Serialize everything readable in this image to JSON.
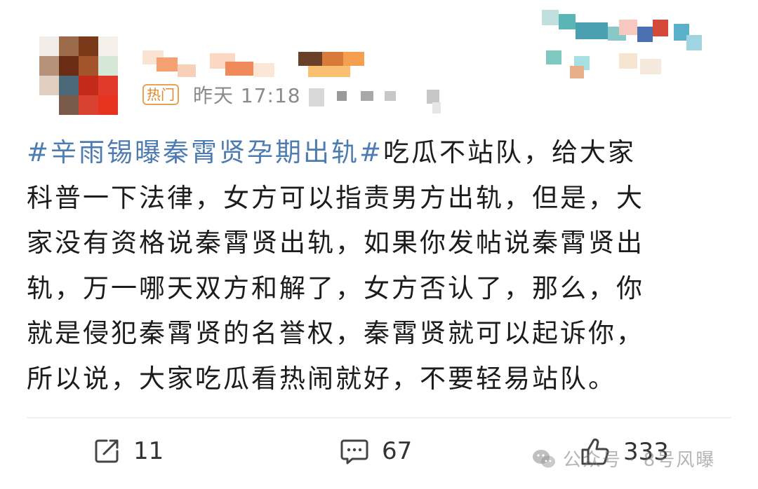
{
  "header": {
    "hot_badge": "热门",
    "time_text": "昨天 17:18"
  },
  "post": {
    "hashtag": "#辛雨锡曝秦霄贤孕期出轨#",
    "line1_rest": "吃瓜不站队，给大家",
    "line2": "科普一下法律，女方可以指责男方出轨，但是，大",
    "line3": "家没有资格说秦霄贤出轨，如果你发帖说秦霄贤出",
    "line4": "轨，万一哪天双方和解了，女方否认了，那么，你",
    "line5": "就是侵犯秦霄贤的名誉权，秦霄贤就可以起诉你，",
    "line6": "所以说，大家吃瓜看热闹就好，不要轻易站队。"
  },
  "actions": {
    "share_count": "11",
    "comment_count": "67",
    "like_count": "333"
  },
  "watermark": {
    "text": "公众号 · 8号风曝"
  },
  "colors": {
    "hashtag": "#4d7cb3",
    "hot_badge": "#e08a2e",
    "meta": "#8a8a8a"
  },
  "icons": [
    "share-icon",
    "comment-icon",
    "like-icon",
    "wechat-logo-icon"
  ]
}
